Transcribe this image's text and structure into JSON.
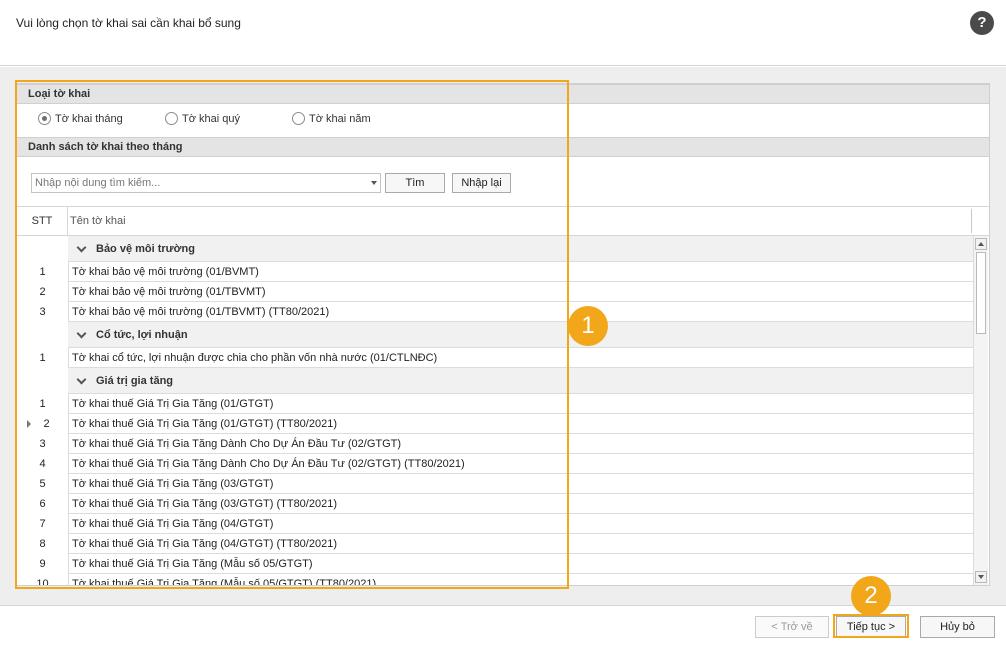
{
  "header": {
    "title": "Vui lòng chọn tờ khai sai cần khai bổ sung",
    "help_symbol": "?"
  },
  "loai_to_khai": {
    "title": "Loại tờ khai",
    "options": [
      {
        "label": "Tờ khai tháng",
        "checked": true
      },
      {
        "label": "Tờ khai quý",
        "checked": false
      },
      {
        "label": "Tờ khai năm",
        "checked": false
      }
    ]
  },
  "list_section": {
    "title": "Danh sách tờ khai theo tháng",
    "search_placeholder": "Nhập nội dung tìm kiếm...",
    "search_button": "Tìm",
    "reset_button": "Nhập lại"
  },
  "grid": {
    "columns": [
      "STT",
      "Tên tờ khai"
    ],
    "groups": [
      {
        "name": "Bảo vệ môi trường",
        "rows": [
          {
            "stt": "1",
            "name": "Tờ khai bảo vệ môi trường (01/BVMT)"
          },
          {
            "stt": "2",
            "name": "Tờ khai bảo vệ môi trường (01/TBVMT)"
          },
          {
            "stt": "3",
            "name": "Tờ khai bảo vệ môi trường (01/TBVMT) (TT80/2021)"
          }
        ]
      },
      {
        "name": "Cổ tức, lợi nhuận",
        "rows": [
          {
            "stt": "1",
            "name": "Tờ khai cổ tức, lợi nhuận được chia cho phần vốn nhà nước (01/CTLNĐC)"
          }
        ]
      },
      {
        "name": "Giá trị gia tăng",
        "rows": [
          {
            "stt": "1",
            "name": "Tờ khai thuế Giá Trị Gia Tăng (01/GTGT)"
          },
          {
            "stt": "2",
            "name": "Tờ khai thuế Giá Trị Gia Tăng (01/GTGT) (TT80/2021)",
            "current": true
          },
          {
            "stt": "3",
            "name": "Tờ khai thuế Giá Trị Gia Tăng Dành Cho Dự Án Đầu Tư (02/GTGT)"
          },
          {
            "stt": "4",
            "name": "Tờ khai thuế Giá Trị Gia Tăng Dành Cho Dự Án Đầu Tư (02/GTGT) (TT80/2021)"
          },
          {
            "stt": "5",
            "name": "Tờ khai thuế Giá Trị Gia Tăng (03/GTGT)"
          },
          {
            "stt": "6",
            "name": "Tờ khai thuế Giá Trị Gia Tăng (03/GTGT) (TT80/2021)"
          },
          {
            "stt": "7",
            "name": "Tờ khai thuế Giá Trị Gia Tăng (04/GTGT)"
          },
          {
            "stt": "8",
            "name": "Tờ khai thuế Giá Trị Gia Tăng (04/GTGT) (TT80/2021)"
          },
          {
            "stt": "9",
            "name": "Tờ khai thuế Giá Trị Gia Tăng (Mẫu số 05/GTGT)"
          },
          {
            "stt": "10",
            "name": "Tờ khai thuế Giá Trị Gia Tăng (Mẫu số 05/GTGT) (TT80/2021)"
          }
        ]
      }
    ]
  },
  "annotations": {
    "step1": "1",
    "step2": "2",
    "accent_color": "#f2a71b"
  },
  "footer": {
    "back_label": "< Trở về",
    "next_label": "Tiếp tục >",
    "cancel_label": "Hủy bỏ"
  }
}
